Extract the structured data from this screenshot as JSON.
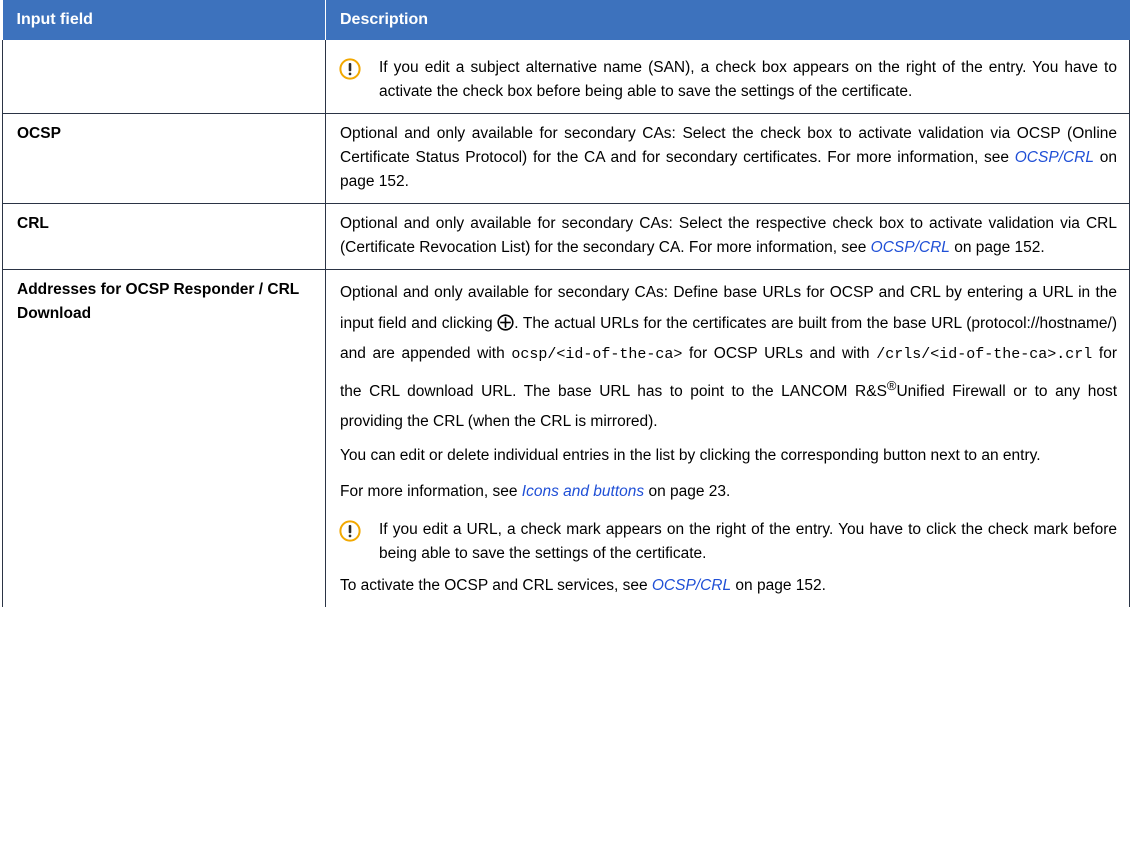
{
  "header": {
    "col1": "Input field",
    "col2": "Description"
  },
  "row0": {
    "note": "If you edit a subject alternative name (SAN), a check box appears on the right of the entry. You have to activate the check box before being able to save the settings of the certificate."
  },
  "row_ocsp": {
    "name": "OCSP",
    "desc_a": "Optional and only available for secondary CAs: Select the check box to activate validation via OCSP (Online Certificate Status Protocol) for the CA and for secondary certificates. For more information, see ",
    "link": "OCSP/CRL",
    "desc_b": " on page 152."
  },
  "row_crl": {
    "name": "CRL",
    "desc_a": "Optional and only available for secondary CAs: Select the respective check box to activate validation via CRL (Certificate Revocation List) for the secondary CA. For more information, see ",
    "link": "OCSP/CRL",
    "desc_b": " on page 152."
  },
  "row_addr": {
    "name": "Addresses for OCSP Responder / CRL Download",
    "p1_a": "Optional and only available for secondary CAs: Define base URLs for OCSP and CRL by entering a URL in the input field and clicking ",
    "p1_b": ". The actual URLs for the certificates are built from the base URL (protocol://hostname/) and are appended with ",
    "code1": "ocsp/<id-of-the-ca>",
    "p1_c": " for OCSP URLs and with ",
    "code2": "/crls/<id-of-the-ca>.crl",
    "p1_d": " for the CRL download URL. The base URL has to point to the LANCOM R&S",
    "reg": "®",
    "p1_e": "Unified Firewall or to any host providing the CRL (when the CRL is mirrored).",
    "p2": "You can edit or delete individual entries in the list by clicking the corresponding button next to an entry.",
    "p3_a": "For more information, see ",
    "p3_link": "Icons and buttons",
    "p3_b": " on page 23.",
    "note": "If you edit a URL, a check mark appears on the right of the entry. You have to click the check mark before being able to save the settings of the certificate.",
    "p4_a": "To activate the OCSP and CRL services, see ",
    "p4_link": "OCSP/CRL",
    "p4_b": " on page 152."
  },
  "icons": {
    "warning": "exclamation-circle-icon",
    "add": "circled-plus-icon"
  },
  "colors": {
    "header_bg": "#3d72bd",
    "link": "#1f4fd6",
    "warning": "#f2a800"
  }
}
